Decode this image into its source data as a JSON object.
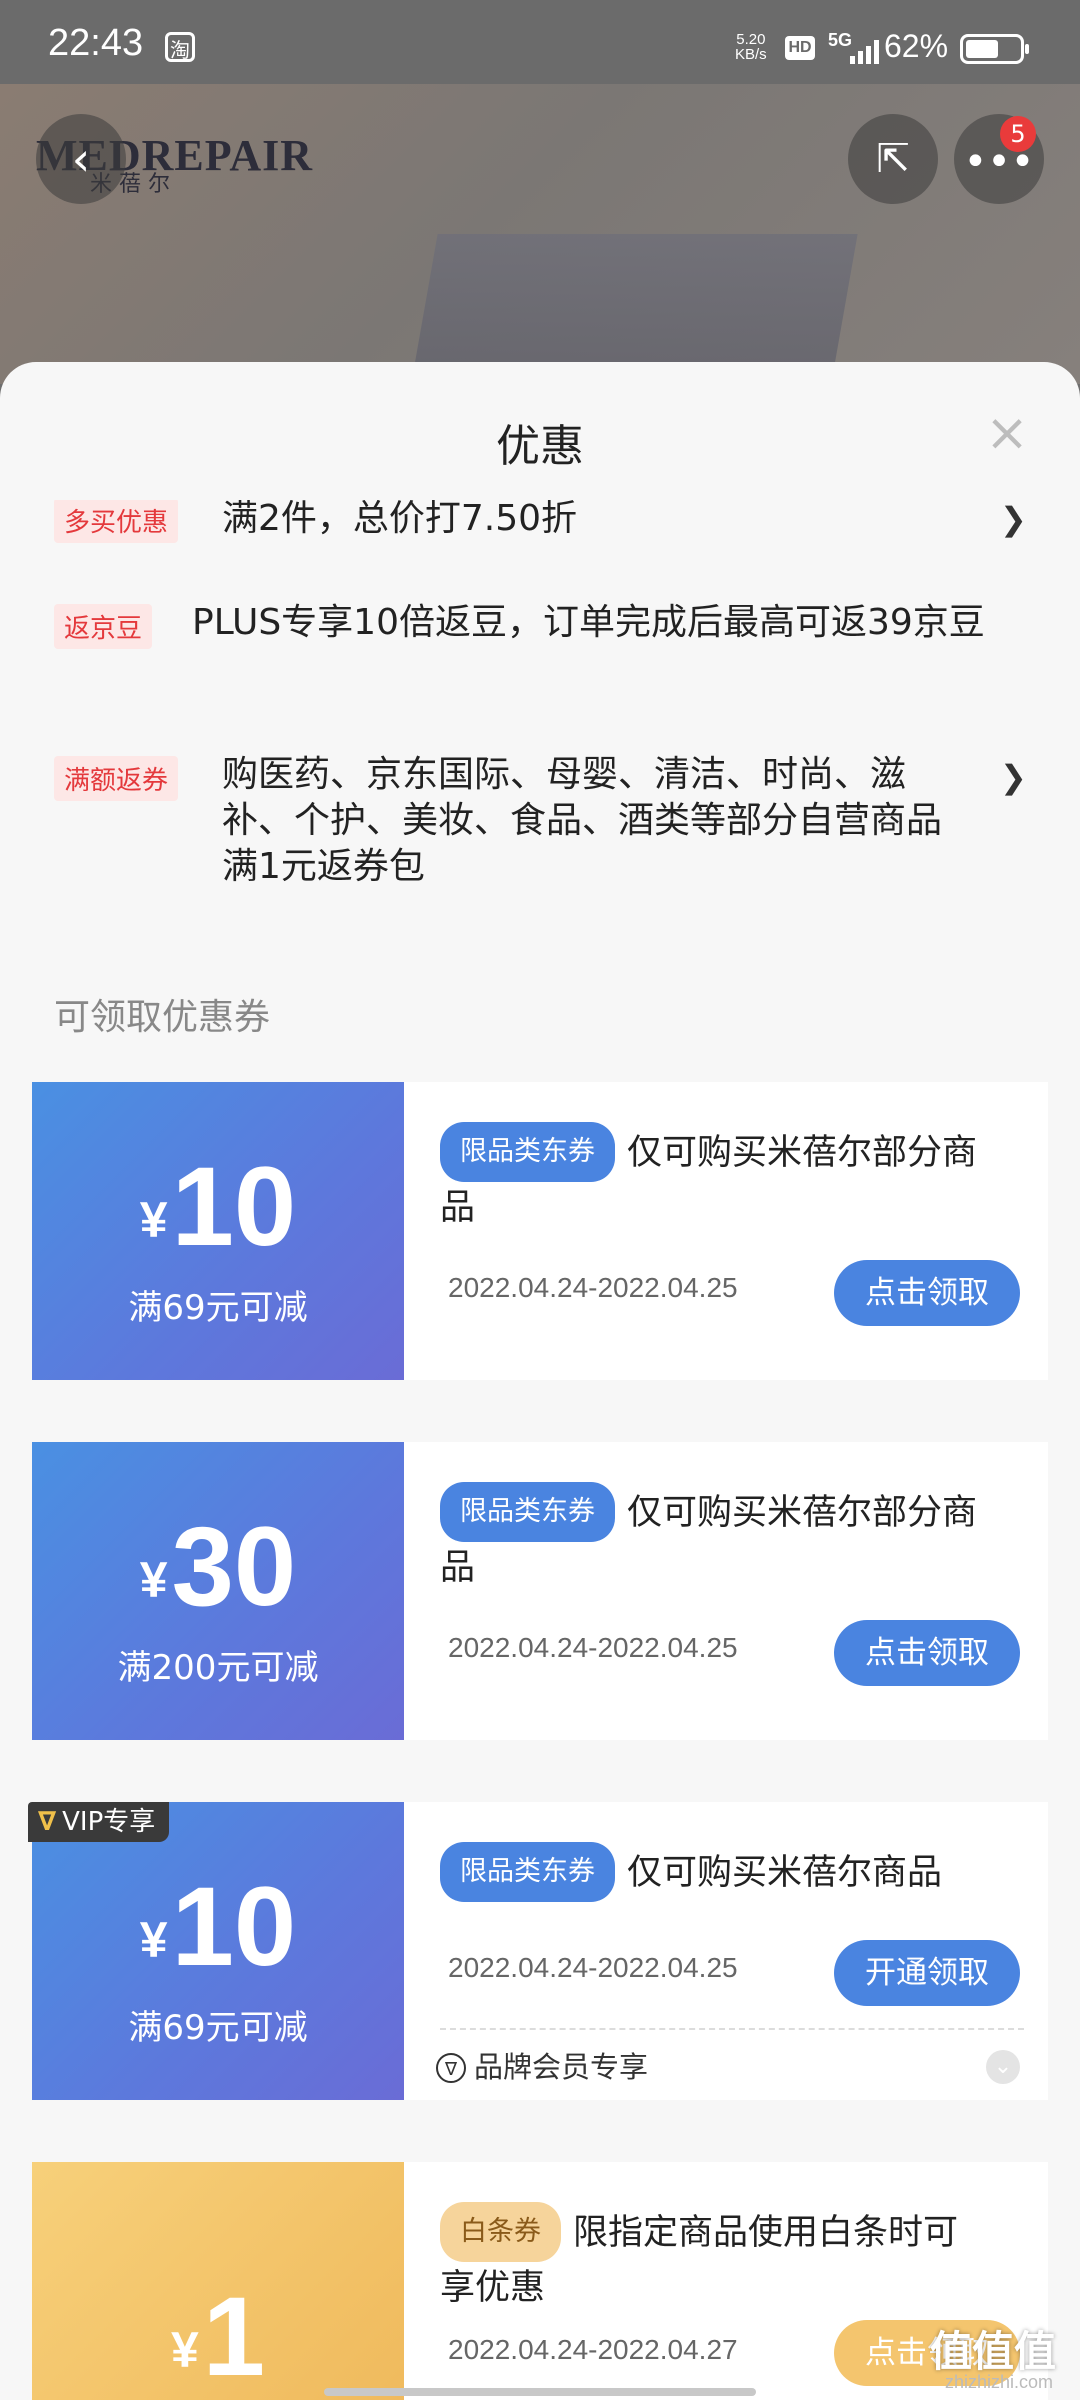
{
  "status_bar": {
    "time": "22:43",
    "app_icon": "淘",
    "speed_value": "5.20",
    "speed_unit": "KB/s",
    "hd": "HD",
    "network": "5G",
    "battery": "62%",
    "battery_level": 0.62
  },
  "header": {
    "logo": "MEDREPAIR",
    "logo_sub": "米 蓓 尔",
    "badge_count": "5"
  },
  "sheet": {
    "title": "优惠",
    "close": "×"
  },
  "promotions": [
    {
      "tag": "多买优惠",
      "text": "满2件，总价打7.50折",
      "has_arrow": true
    },
    {
      "tag": "返京豆",
      "text": "PLUS专享10倍返豆，订单完成后最高可返39京豆",
      "has_arrow": false
    },
    {
      "tag": "满额返券",
      "text": "购医药、京东国际、母婴、清洁、时尚、滋补、个护、美妆、食品、酒类等部分自营商品满1元返券包",
      "has_arrow": true
    }
  ],
  "section_label": "可领取优惠券",
  "coupons": [
    {
      "currency": "¥",
      "amount": "10",
      "condition": "满69元可减",
      "pill": "限品类东券",
      "desc": "仅可购买米蓓尔部分商品",
      "date": "2022.04.24-2022.04.25",
      "button": "点击领取"
    },
    {
      "currency": "¥",
      "amount": "30",
      "condition": "满200元可减",
      "pill": "限品类东券",
      "desc": "仅可购买米蓓尔部分商品",
      "date": "2022.04.24-2022.04.25",
      "button": "点击领取"
    },
    {
      "currency": "¥",
      "amount": "10",
      "condition": "满69元可减",
      "pill": "限品类东券",
      "desc": "仅可购买米蓓尔商品",
      "date": "2022.04.24-2022.04.25",
      "button": "开通领取",
      "vip_badge": "VIP专享",
      "member_note": "品牌会员专享"
    },
    {
      "currency": "¥",
      "amount": "1",
      "condition": "",
      "pill": "白条券",
      "desc": "限指定商品使用白条时可享优惠",
      "date": "2022.04.24-2022.04.27",
      "button": "点击领取"
    }
  ],
  "watermark": {
    "text": "值值值",
    "sub": "zhizhizhi.com"
  },
  "colors": {
    "accent_blue": "#4a84e0",
    "coupon_gradient_start": "#4a90e2",
    "coupon_gradient_end": "#6a6cd6",
    "tag_red": "#e4393c",
    "gold": "#f4c56e"
  }
}
